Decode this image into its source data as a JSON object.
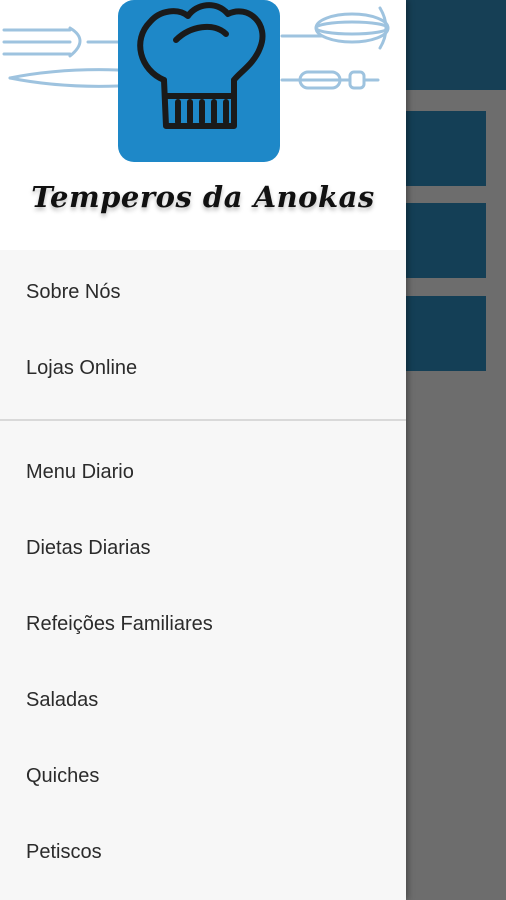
{
  "header": {
    "brand_title": "Temperos da Anokas",
    "logo_icon": "chef-hat-icon",
    "decor_icons": [
      "fork-icon",
      "whisk-icon",
      "rolling-pin-icon"
    ],
    "logo_color": "#1e88c8"
  },
  "menu": {
    "group1": [
      {
        "label": "Sobre Nós"
      },
      {
        "label": "Lojas Online"
      }
    ],
    "group2": [
      {
        "label": "Menu Diario"
      },
      {
        "label": "Dietas Diarias"
      },
      {
        "label": "Refeições Familiares"
      },
      {
        "label": "Saladas"
      },
      {
        "label": "Quiches"
      },
      {
        "label": "Petiscos"
      }
    ]
  },
  "colors": {
    "drawer_bg": "#f7f7f7",
    "scrim": "#6d6d6d",
    "actionbar": "#163f55"
  }
}
